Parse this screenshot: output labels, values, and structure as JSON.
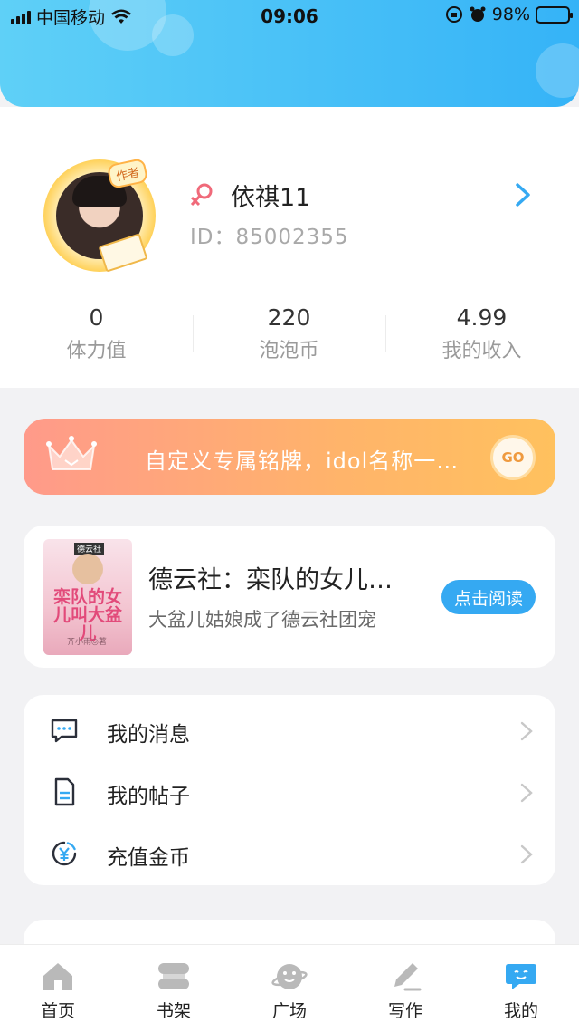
{
  "status_bar": {
    "carrier": "中国移动",
    "time": "09:06",
    "battery_percent": "98%"
  },
  "profile": {
    "avatar_badge": "作者",
    "username": "依祺11",
    "user_id": "ID：85002355",
    "stats": [
      {
        "value": "0",
        "label": "体力值"
      },
      {
        "value": "220",
        "label": "泡泡币"
      },
      {
        "value": "4.99",
        "label": "我的收入"
      }
    ]
  },
  "banner": {
    "text": "自定义专属铭牌，idol名称一…",
    "go_label": "GO"
  },
  "book": {
    "title": "德云社：栾队的女儿…",
    "description": "大盆儿姑娘成了德云社团宠",
    "read_label": "点击阅读",
    "cover_tag": "德云社",
    "cover_title": "栾队的女儿叫大盆儿",
    "cover_author": "齐小雨◎著"
  },
  "menu": {
    "items": [
      {
        "label": "我的消息",
        "icon": "message-icon"
      },
      {
        "label": "我的帖子",
        "icon": "document-icon"
      },
      {
        "label": "充值金币",
        "icon": "coin-icon"
      }
    ]
  },
  "tabbar": {
    "tabs": [
      {
        "label": "首页",
        "icon": "home-icon"
      },
      {
        "label": "书架",
        "icon": "bookshelf-icon"
      },
      {
        "label": "广场",
        "icon": "planet-icon"
      },
      {
        "label": "写作",
        "icon": "pen-icon"
      },
      {
        "label": "我的",
        "icon": "chat-bubble-icon"
      }
    ],
    "active_color": "#35a9f2",
    "inactive_color": "#b9b9b9"
  },
  "colors": {
    "header_start": "#5fd0f7",
    "header_end": "#35b3f7",
    "banner_start": "#ff9a8a",
    "banner_end": "#ffc15e",
    "accent": "#35a9f2"
  }
}
